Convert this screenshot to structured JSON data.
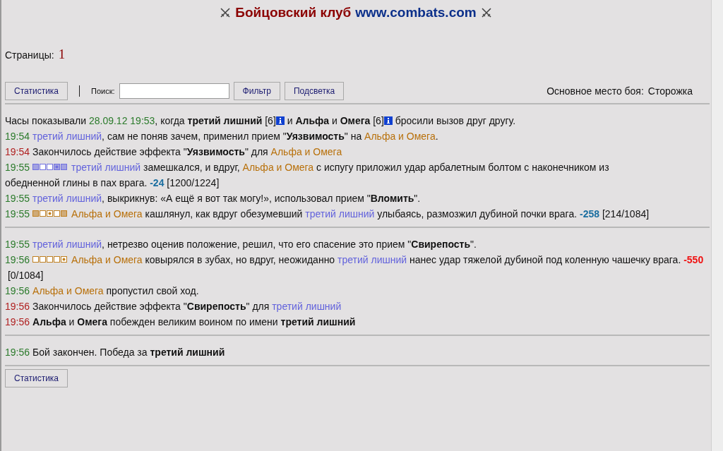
{
  "header": {
    "title": "Бойцовский клуб",
    "site": "www.combats.com"
  },
  "pages": {
    "label": "Страницы:",
    "current": "1"
  },
  "toolbar": {
    "stats_button": "Статистика",
    "search_label": "Поиск:",
    "filter_button": "Фильтр",
    "highlight_button": "Подсветка",
    "location_label": "Основное место боя:",
    "location": "Сторожка"
  },
  "log": [
    [
      {
        "parts": [
          {
            "kind": "text",
            "t": "Часы показывали "
          },
          {
            "kind": "date",
            "t": "28.09.12 19:53"
          },
          {
            "kind": "text",
            "t": ", когда **третий лишний** [6]"
          },
          {
            "kind": "info"
          },
          {
            "kind": "text",
            "t": " и **Альфа** и **Омега** [6]"
          },
          {
            "kind": "info"
          },
          {
            "kind": "text",
            "t": " бросили вызов друг другу."
          }
        ]
      },
      {
        "time": "19:54",
        "color": "#2a7a2a",
        "parts": [
          {
            "kind": "player",
            "color": "#6262dc",
            "t": "третий лишний"
          },
          {
            "kind": "text",
            "t": ", сам не поняв зачем, применил прием \"**Уязвимость**\" на "
          },
          {
            "kind": "player",
            "color": "#b8700a",
            "t": "Альфа и Омега"
          },
          {
            "kind": "text",
            "t": "."
          }
        ]
      },
      {
        "time": "19:54",
        "color": "#b02020",
        "parts": [
          {
            "kind": "text",
            "t": "Закончилось действие эффекта \"**Уязвимость**\" для "
          },
          {
            "kind": "player",
            "color": "#b8700a",
            "t": "Альфа и Омега"
          }
        ]
      },
      {
        "time": "19:55",
        "color": "#2a7a2a",
        "parts": [
          {
            "kind": "zones",
            "color": "#7070e0",
            "cells": [
              {
                "filled": true,
                "dot": false
              },
              {
                "filled": false,
                "dot": false
              },
              {
                "filled": false,
                "dot": false
              },
              {
                "filled": true,
                "dot": true
              },
              {
                "filled": true,
                "dot": false
              }
            ]
          },
          {
            "kind": "player",
            "color": "#6262dc",
            "t": "третий лишний"
          },
          {
            "kind": "text",
            "t": " замешкался, и вдруг, "
          },
          {
            "kind": "player",
            "color": "#b8700a",
            "t": "Альфа и Омега"
          },
          {
            "kind": "text",
            "t": " с испугу приложил удар арбалетным болтом с наконечником из "
          },
          {
            "kind": "text",
            "t": "обедненной глины в пах врага. "
          },
          {
            "kind": "damage",
            "color": "#1a6ea0",
            "t": "-24"
          },
          {
            "kind": "text",
            "t": " [1200/1224]"
          }
        ]
      },
      {
        "time": "19:55",
        "color": "#2a7a2a",
        "parts": [
          {
            "kind": "player",
            "color": "#6262dc",
            "t": "третий лишний"
          },
          {
            "kind": "text",
            "t": ", выкрикнув: «А ещё я вот так могу!», использовал прием \"**Вломить**\"."
          }
        ]
      },
      {
        "time": "19:55",
        "color": "#2a7a2a",
        "parts": [
          {
            "kind": "zones",
            "color": "#c08020",
            "cells": [
              {
                "filled": true,
                "dot": false
              },
              {
                "filled": false,
                "dot": false
              },
              {
                "filled": false,
                "dot": true
              },
              {
                "filled": false,
                "dot": false
              },
              {
                "filled": true,
                "dot": false
              }
            ]
          },
          {
            "kind": "player",
            "color": "#b8700a",
            "t": "Альфа и Омега"
          },
          {
            "kind": "text",
            "t": " кашлянул, как вдруг обезумевший "
          },
          {
            "kind": "player",
            "color": "#6262dc",
            "t": "третий лишний"
          },
          {
            "kind": "text",
            "t": " улыбаясь, размозжил дубиной почки врага. "
          },
          {
            "kind": "damage",
            "color": "#1a6ea0",
            "t": "-258"
          },
          {
            "kind": "text",
            "t": " [214/1084]"
          }
        ]
      }
    ],
    [
      {
        "time": "19:55",
        "color": "#2a7a2a",
        "parts": [
          {
            "kind": "player",
            "color": "#6262dc",
            "t": "третий лишний"
          },
          {
            "kind": "text",
            "t": ", нетрезво оценив положение, решил, что его спасение это прием \"**Свирепость**\"."
          }
        ]
      },
      {
        "time": "19:56",
        "color": "#2a7a2a",
        "parts": [
          {
            "kind": "zones",
            "color": "#c08020",
            "cells": [
              {
                "filled": false,
                "dot": false
              },
              {
                "filled": false,
                "dot": false
              },
              {
                "filled": false,
                "dot": false
              },
              {
                "filled": false,
                "dot": false
              },
              {
                "filled": false,
                "dot": true
              }
            ]
          },
          {
            "kind": "player",
            "color": "#b8700a",
            "t": "Альфа и Омега"
          },
          {
            "kind": "text",
            "t": " ковырялся в зубах, но вдруг, неожиданно "
          },
          {
            "kind": "player",
            "color": "#6262dc",
            "t": "третий лишний"
          },
          {
            "kind": "text",
            "t": " нанес удар тяжелой дубиной под коленную чашечку "
          },
          {
            "kind": "text",
            "t": "врага. "
          },
          {
            "kind": "damage",
            "color": "#f01010",
            "t": "-550"
          },
          {
            "kind": "text",
            "t": " [0/1084]"
          }
        ]
      },
      {
        "time": "19:56",
        "color": "#2a7a2a",
        "parts": [
          {
            "kind": "player",
            "color": "#b8700a",
            "t": "Альфа и Омега"
          },
          {
            "kind": "text",
            "t": " пропустил свой ход."
          }
        ]
      },
      {
        "time": "19:56",
        "color": "#b02020",
        "parts": [
          {
            "kind": "text",
            "t": "Закончилось действие эффекта \"**Свирепость**\" для "
          },
          {
            "kind": "player",
            "color": "#6262dc",
            "t": "третий лишний"
          }
        ]
      },
      {
        "time": "19:56",
        "color": "#b02020",
        "parts": [
          {
            "kind": "text",
            "t": "**Альфа** и **Омега** побежден великим воином по имени **третий лишний**"
          }
        ]
      }
    ],
    [
      {
        "time": "19:56",
        "color": "#2a7a2a",
        "parts": [
          {
            "kind": "text",
            "t": "Бой закончен. Победа за **третий лишний**"
          }
        ]
      }
    ]
  ],
  "footer": {
    "stats_button": "Статистика"
  }
}
